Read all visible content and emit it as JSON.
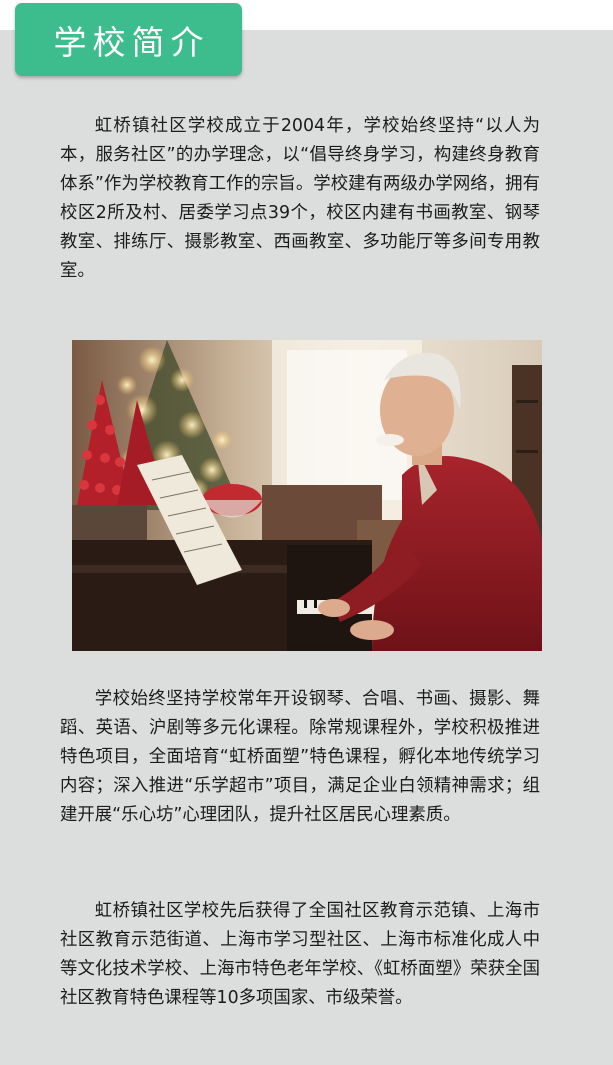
{
  "section_title": "学校简介",
  "paragraphs": [
    "虹桥镇社区学校成立于2004年，学校始终坚持“以人为本，服务社区”的办学理念，以“倡导终身学习，构建终身教育体系”作为学校教育工作的宗旨。学校建有两级办学网络，拥有校区2所及村、居委学习点39个，校区内建有书画教室、钢琴教室、排练厅、摄影教室、西画教室、多功能厅等多间专用教室。",
    "学校始终坚持学校常年开设钢琴、合唱、书画、摄影、舞蹈、英语、沪剧等多元化课程。除常规课程外，学校积极推进特色项目，全面培育“虹桥面塑”特色课程，孵化本地传统学习内容；深入推进“乐学超市”项目，满足企业白领精神需求；组建开展“乐心坊”心理团队，提升社区居民心理素质。",
    "虹桥镇社区学校先后获得了全国社区教育示范镇、上海市社区教育示范街道、上海市学习型社区、上海市标准化成人中等文化技术学校、上海市特色老年学校、《虹桥面塑》荣获全国社区教育特色课程等10多项国家、市级荣誉。"
  ],
  "colors": {
    "tab_background": "#3dbd8d",
    "panel_background": "#dcdddd",
    "text": "#1c1c1c"
  }
}
